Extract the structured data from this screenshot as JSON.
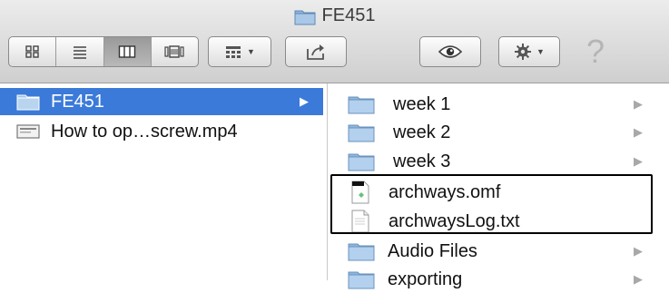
{
  "window": {
    "title": "FE451",
    "title_icon": "folder-icon"
  },
  "toolbar": {
    "view_modes": [
      {
        "name": "icon-view",
        "icon": "grid-icon",
        "active": false
      },
      {
        "name": "list-view",
        "icon": "list-icon",
        "active": false
      },
      {
        "name": "column-view",
        "icon": "columns-icon",
        "active": true
      },
      {
        "name": "coverflow-view",
        "icon": "coverflow-icon",
        "active": false
      }
    ],
    "arrange_icon": "arrange-icon",
    "share_icon": "share-icon",
    "quicklook_icon": "eye-icon",
    "action_icon": "gear-icon",
    "help_label": "?"
  },
  "left_column": {
    "items": [
      {
        "label": "FE451",
        "type": "folder",
        "selected": true,
        "has_children": true
      },
      {
        "label": "How to op…screw.mp4",
        "type": "video",
        "selected": false,
        "has_children": false
      }
    ]
  },
  "right_column": {
    "items": [
      {
        "label": "week 1",
        "type": "folder",
        "has_children": true
      },
      {
        "label": "week 2",
        "type": "folder",
        "has_children": true
      },
      {
        "label": "week 3",
        "type": "folder",
        "has_children": true
      },
      {
        "label": "archways.omf",
        "type": "omf-file",
        "has_children": false
      },
      {
        "label": "archwaysLog.txt",
        "type": "text-file",
        "has_children": false
      },
      {
        "label": "Audio Files",
        "type": "folder",
        "has_children": true
      },
      {
        "label": "exporting",
        "type": "folder",
        "has_children": true
      }
    ]
  },
  "colors": {
    "selection": "#3b7ad9",
    "folder": "#8fb6dc"
  }
}
